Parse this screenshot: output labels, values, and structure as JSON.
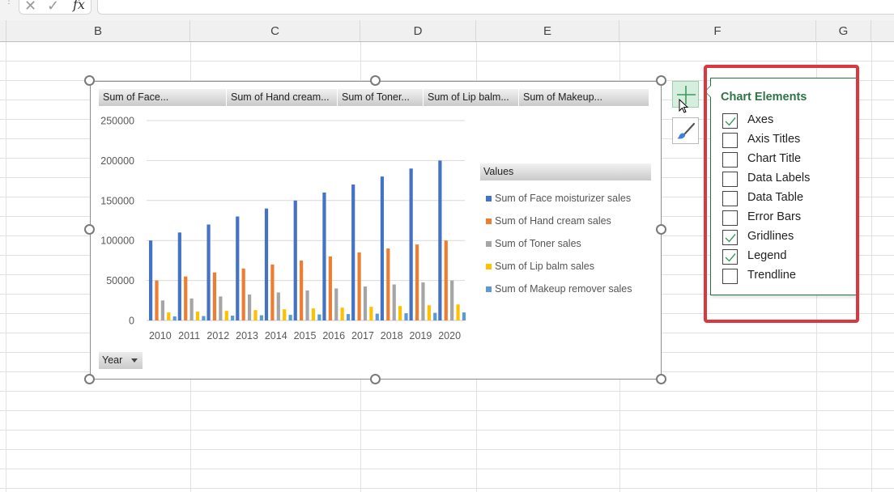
{
  "formula_bar": {
    "cancel_icon": "x-icon",
    "enter_icon": "check-icon",
    "fx_label": "fx",
    "value": ""
  },
  "columns": [
    "B",
    "C",
    "D",
    "E",
    "F",
    "G"
  ],
  "chart": {
    "field_buttons": [
      "Sum of Face...",
      "Sum of Hand cream...",
      "Sum of Toner...",
      "Sum of Lip balm...",
      "Sum of Makeup..."
    ],
    "legend_title": "Values",
    "axis_field_button": "Year",
    "colors": [
      "#4472c4",
      "#ed7d31",
      "#a5a5a5",
      "#ffc000",
      "#5b9bd5"
    ]
  },
  "chart_data": {
    "type": "bar",
    "title": "",
    "xlabel": "",
    "ylabel": "",
    "ylim": [
      0,
      250000
    ],
    "yticks": [
      0,
      50000,
      100000,
      150000,
      200000,
      250000
    ],
    "ytick_labels": [
      "0",
      "50000",
      "100000",
      "150000",
      "200000",
      "250000"
    ],
    "grid": true,
    "legend_position": "right",
    "categories": [
      "2010",
      "2011",
      "2012",
      "2013",
      "2014",
      "2015",
      "2016",
      "2017",
      "2018",
      "2019",
      "2020"
    ],
    "series": [
      {
        "name": "Sum of Face moisturizer sales",
        "values": [
          100000,
          110000,
          120000,
          130000,
          140000,
          150000,
          160000,
          170000,
          180000,
          190000,
          200000
        ]
      },
      {
        "name": "Sum of Hand cream sales",
        "values": [
          50000,
          55000,
          60000,
          65000,
          70000,
          75000,
          80000,
          85000,
          90000,
          95000,
          100000
        ]
      },
      {
        "name": "Sum of Toner sales",
        "values": [
          25000,
          27500,
          30000,
          32500,
          35000,
          37500,
          40000,
          42500,
          45000,
          47500,
          50000
        ]
      },
      {
        "name": "Sum of Lip balm sales",
        "values": [
          10000,
          11000,
          12000,
          13000,
          14000,
          15000,
          16000,
          17000,
          18000,
          19000,
          20000
        ]
      },
      {
        "name": "Sum of Makeup remover sales",
        "values": [
          5000,
          5500,
          6000,
          6500,
          7000,
          7500,
          8000,
          8500,
          9000,
          9500,
          10000
        ]
      }
    ]
  },
  "side_buttons": {
    "chart_elements_icon": "plus-icon",
    "chart_styles_icon": "paintbrush-icon"
  },
  "chart_elements_panel": {
    "title": "Chart Elements",
    "accent_color": "#2f7447",
    "highlight_color": "#d9393e",
    "options": [
      {
        "label": "Axes",
        "checked": true
      },
      {
        "label": "Axis Titles",
        "checked": false
      },
      {
        "label": "Chart Title",
        "checked": false
      },
      {
        "label": "Data Labels",
        "checked": false
      },
      {
        "label": "Data Table",
        "checked": false
      },
      {
        "label": "Error Bars",
        "checked": false
      },
      {
        "label": "Gridlines",
        "checked": true
      },
      {
        "label": "Legend",
        "checked": true
      },
      {
        "label": "Trendline",
        "checked": false
      }
    ]
  }
}
